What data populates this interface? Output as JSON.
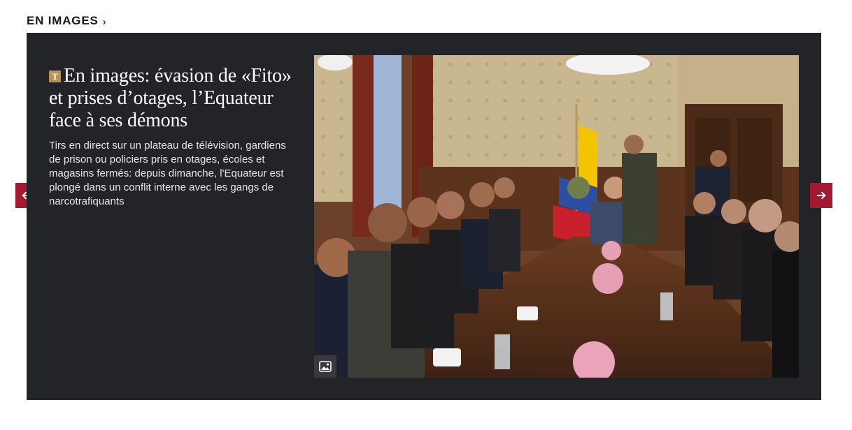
{
  "section": {
    "title": "EN IMAGES",
    "chevron": "›"
  },
  "article": {
    "badge": "T",
    "headline": "En images: évasion de «Fito» et prises d’otages, l’Equateur face à ses démons",
    "summary": "Tirs en direct sur un plateau de télévision, gardiens de prison ou policiers pris en otages, écoles et magasins fermés: depuis dimanche, l'Equateur est plongé dans un conflit interne avec les gangs de narcotrafiquants"
  },
  "icons": {
    "prev": "arrow-left-icon",
    "next": "arrow-right-icon",
    "gallery": "image-gallery-icon"
  },
  "colors": {
    "accent": "#a31a30",
    "panel": "#232427",
    "badge": "#b5925b"
  }
}
